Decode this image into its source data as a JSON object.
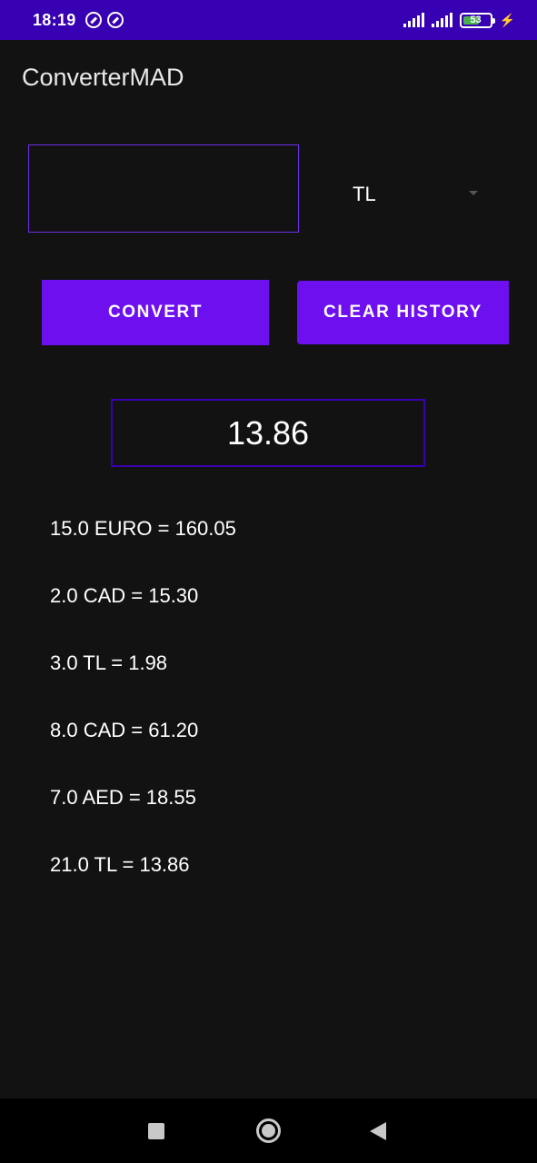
{
  "status_bar": {
    "time": "18:19",
    "battery_level": "53",
    "notification_icons": [
      "sync-icon",
      "sync-icon"
    ],
    "background_color": "#3700b3"
  },
  "app": {
    "title": "ConverterMAD",
    "accent_color": "#6e0ff0"
  },
  "converter": {
    "amount_value": "",
    "amount_placeholder": "",
    "currency_selected": "TL",
    "convert_label": "CONVERT",
    "clear_history_label": "CLEAR HISTORY",
    "result": "13.86"
  },
  "history": [
    "15.0 EURO = 160.05",
    "2.0 CAD = 15.30",
    "3.0 TL = 1.98",
    "8.0 CAD = 61.20",
    "7.0 AED = 18.55",
    "21.0 TL = 13.86"
  ],
  "nav_bar": {
    "icons": [
      "recents-icon",
      "home-icon",
      "back-icon"
    ]
  }
}
